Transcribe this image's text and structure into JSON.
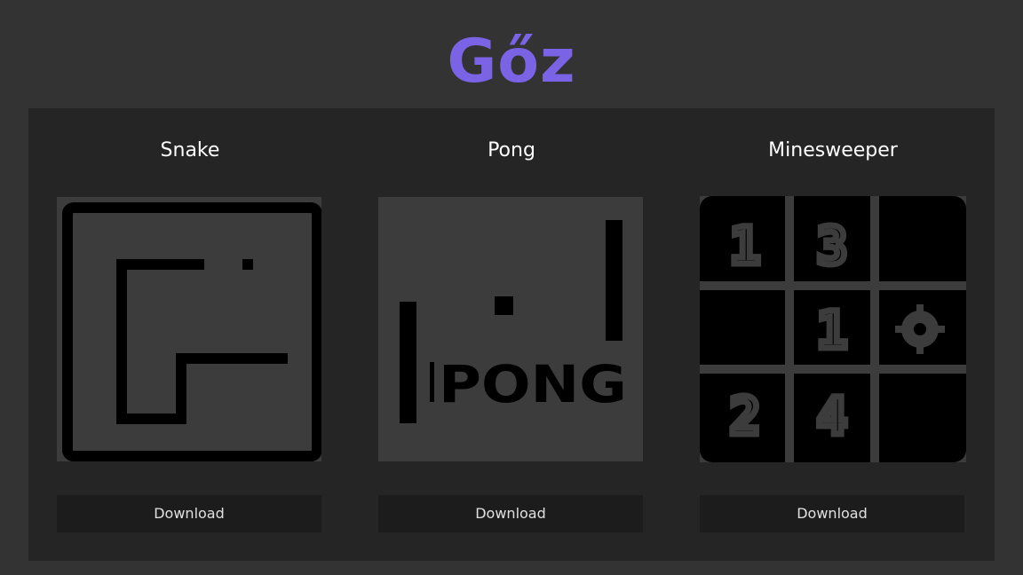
{
  "site": {
    "title": "Gőz",
    "title_color": "#7b63e6"
  },
  "games": [
    {
      "name": "Snake",
      "download_label": "Download",
      "icon": "snake-game-icon"
    },
    {
      "name": "Pong",
      "download_label": "Download",
      "icon": "pong-game-icon"
    },
    {
      "name": "Minesweeper",
      "download_label": "Download",
      "icon": "minesweeper-game-icon"
    }
  ],
  "pong_icon": {
    "wordmark": "PONG"
  },
  "minesweeper_icon": {
    "cells": [
      "1",
      "3",
      "",
      "",
      "1",
      "mine",
      "2",
      "4",
      ""
    ],
    "mine_icon": "mine-icon"
  }
}
